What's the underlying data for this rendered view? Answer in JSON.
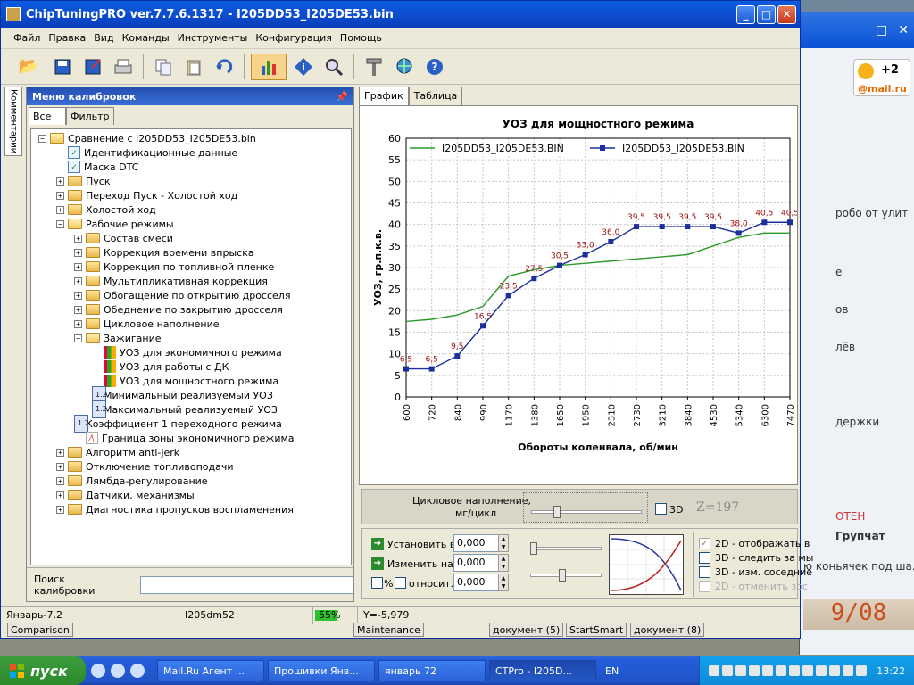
{
  "window": {
    "title": "ChipTuningPRO ver.7.7.6.1317 - I205DD53_I205DE53.bin",
    "buttons": {
      "minimize": "_",
      "maximize": "□",
      "close": "✕"
    }
  },
  "menu": [
    "Файл",
    "Правка",
    "Вид",
    "Команды",
    "Инструменты",
    "Конфигурация",
    "Помощь"
  ],
  "toolbar": {
    "icons": [
      "open-icon",
      "save-icon",
      "save-as-icon",
      "print-icon",
      "copy-icon",
      "paste-icon",
      "undo-icon",
      "chart-icon",
      "info-icon",
      "zoom-icon",
      "tools-icon",
      "network-icon",
      "help-icon"
    ]
  },
  "sidetab": {
    "label": "Комментарии"
  },
  "calib_panel": {
    "header": "Меню калибровок",
    "tabs": [
      "Все",
      "Фильтр"
    ],
    "search_label": "Поиск калибровки",
    "search_value": ""
  },
  "tree": [
    {
      "label": "Сравнение с I205DD53_I205DE53.bin",
      "level": 0,
      "exp": "−",
      "icon": "folder-open"
    },
    {
      "label": "Идентификационные данные",
      "level": 1,
      "exp": "",
      "icon": "check"
    },
    {
      "label": "Маска DTC",
      "level": 1,
      "exp": "",
      "icon": "check"
    },
    {
      "label": "Пуск",
      "level": 1,
      "exp": "+",
      "icon": "folder"
    },
    {
      "label": "Переход Пуск - Холостой ход",
      "level": 1,
      "exp": "+",
      "icon": "folder"
    },
    {
      "label": "Холостой ход",
      "level": 1,
      "exp": "+",
      "icon": "folder"
    },
    {
      "label": "Рабочие режимы",
      "level": 1,
      "exp": "−",
      "icon": "folder-open"
    },
    {
      "label": "Состав смеси",
      "level": 2,
      "exp": "+",
      "icon": "folder"
    },
    {
      "label": "Коррекция времени впрыска",
      "level": 2,
      "exp": "+",
      "icon": "folder"
    },
    {
      "label": "Коррекция по топливной пленке",
      "level": 2,
      "exp": "+",
      "icon": "folder"
    },
    {
      "label": "Мультипликативная коррекция",
      "level": 2,
      "exp": "+",
      "icon": "folder"
    },
    {
      "label": "Обогащение по открытию дросселя",
      "level": 2,
      "exp": "+",
      "icon": "folder"
    },
    {
      "label": "Обеднение по закрытию дросселя",
      "level": 2,
      "exp": "+",
      "icon": "folder"
    },
    {
      "label": "Цикловое наполнение",
      "level": 2,
      "exp": "+",
      "icon": "folder"
    },
    {
      "label": "Зажигание",
      "level": 2,
      "exp": "−",
      "icon": "folder-open"
    },
    {
      "label": "УОЗ для экономичного режима",
      "level": 3,
      "exp": "",
      "icon": "chart"
    },
    {
      "label": "УОЗ для работы с ДК",
      "level": 3,
      "exp": "",
      "icon": "chart"
    },
    {
      "label": "УОЗ для мощностного режима",
      "level": 3,
      "exp": "",
      "icon": "chart"
    },
    {
      "label": "Минимальный реализуемый УОЗ",
      "level": 3,
      "exp": "",
      "icon": "num"
    },
    {
      "label": "Максимальный реализуемый УОЗ",
      "level": 3,
      "exp": "",
      "icon": "num"
    },
    {
      "label": "Коэффициент 1 переходного режима",
      "level": 2,
      "exp": "",
      "icon": "num"
    },
    {
      "label": "Граница зоны экономичного режима",
      "level": 2,
      "exp": "",
      "icon": "wave"
    },
    {
      "label": "Алгоритм anti-jerk",
      "level": 1,
      "exp": "+",
      "icon": "folder"
    },
    {
      "label": "Отключение топливоподачи",
      "level": 1,
      "exp": "+",
      "icon": "folder"
    },
    {
      "label": "Лямбда-регулирование",
      "level": 1,
      "exp": "+",
      "icon": "folder"
    },
    {
      "label": "Датчики, механизмы",
      "level": 1,
      "exp": "+",
      "icon": "folder"
    },
    {
      "label": "Диагностика пропусков воспламенения",
      "level": 1,
      "exp": "+",
      "icon": "folder"
    }
  ],
  "view_tabs": [
    "График",
    "Таблица"
  ],
  "chart_data": {
    "type": "line",
    "title": "УОЗ для мощностного режима",
    "xlabel": "Обороты коленвала, об/мин",
    "ylabel": "УОЗ, гр.п.к.в.",
    "categories": [
      "600",
      "720",
      "840",
      "990",
      "1170",
      "1380",
      "1650",
      "1950",
      "2310",
      "2730",
      "3210",
      "3840",
      "4530",
      "5340",
      "6300",
      "7470"
    ],
    "ylim": [
      0,
      60
    ],
    "yticks": [
      0,
      5,
      10,
      15,
      20,
      25,
      30,
      35,
      40,
      45,
      50,
      55,
      60
    ],
    "grid": true,
    "legend": "top",
    "series": [
      {
        "name": "I205DD53_I205DE53.BIN",
        "color": "#2a9a2a",
        "marker": "none",
        "values": [
          17.5,
          18,
          19,
          21,
          28,
          29.5,
          30.5,
          31,
          31.5,
          32,
          32.5,
          33,
          35,
          37,
          38,
          38
        ]
      },
      {
        "name": "I205DD53_I205DE53.BIN",
        "color": "#1c2f9c",
        "marker": "square",
        "values": [
          6.5,
          6.5,
          9.5,
          16.5,
          23.5,
          27.5,
          30.5,
          33.0,
          36.0,
          39.5,
          39.5,
          39.5,
          39.5,
          38.0,
          40.5,
          40.5
        ],
        "labels": [
          "6,5",
          "6,5",
          "9,5",
          "16,5",
          "23,5",
          "27,5",
          "30,5",
          "33,0",
          "36,0",
          "39,5",
          "39,5",
          "39,5",
          "39,5",
          "38,0",
          "40,5",
          "40,5"
        ]
      }
    ]
  },
  "controls": {
    "slider_label": "Цикловое наполнение,",
    "slider_unit": "мг/цикл",
    "slider_value": 0.23,
    "checkbox_3d": "3D",
    "z_readout": "Z=197",
    "set_label": "Установить в",
    "set_value": "0,000",
    "change_label": "Изменить на",
    "change_value": "0,000",
    "percent_label": "%",
    "relative_label": "относит.",
    "relative_value": "0,000",
    "opts": [
      "2D - отображать в",
      "3D - следить за мы",
      "3D - изм. соседние",
      "2D - отменить зос"
    ]
  },
  "statusbar": {
    "left": "Январь-7.2",
    "file": "I205dm52",
    "progress_text": "55%",
    "progress_value": 0.55,
    "readout": "Y=-5,979"
  },
  "desktop_labels": [
    "Comparison",
    "Maintenance",
    "документ (5)",
    "StartSmart",
    "документ (8)"
  ],
  "bg_window": {
    "close": "✕",
    "count_badge": "+2",
    "mail": "@mail.ru",
    "items": [
      "робо от улит",
      "е",
      "ов",
      "лёв",
      "держки",
      "ОТЕН",
      "Групчат",
      "ю коньячек под ша..."
    ]
  },
  "date_stamp": "9/08",
  "taskbar": {
    "start": "пуск",
    "buttons": [
      "Mail.Ru Агент ...",
      "Прошивки Янв...",
      "январь 72",
      "CTPro - I205D..."
    ],
    "lang": "EN",
    "clock": "13:22"
  }
}
